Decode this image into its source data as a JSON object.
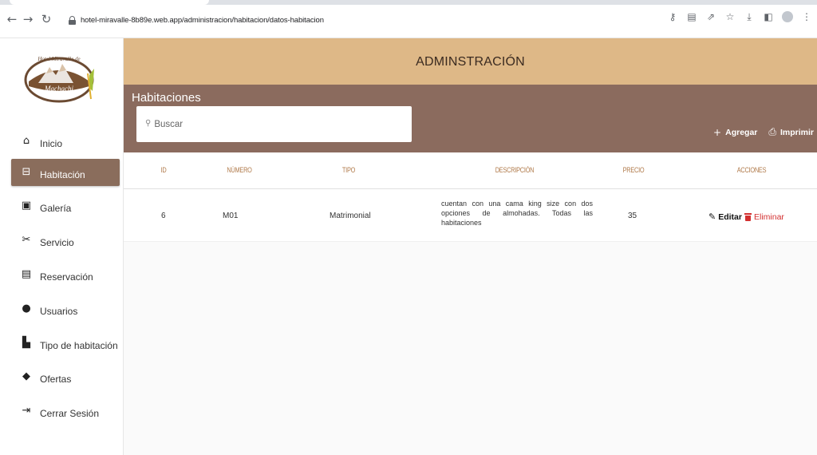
{
  "browser": {
    "url": "hotel-miravalle-8b89e.web.app/administracion/habitacion/datos-habitacion",
    "back_icon": "arrow-left-icon",
    "forward_icon": "arrow-right-icon",
    "reload_icon": "reload-icon"
  },
  "logo": {
    "top_text": "Hotel Miravalle de",
    "bottom_text": "Machachi"
  },
  "sidebar": {
    "items": [
      {
        "label": "Inicio",
        "icon": "home-icon"
      },
      {
        "label": "Habitación",
        "icon": "bed-icon",
        "active": true
      },
      {
        "label": "Galería",
        "icon": "gallery-icon"
      },
      {
        "label": "Servicio",
        "icon": "service-icon"
      },
      {
        "label": "Reservación",
        "icon": "reservation-icon"
      },
      {
        "label": "Usuarios",
        "icon": "user-icon"
      },
      {
        "label": "Tipo de habitación",
        "icon": "room-type-icon"
      },
      {
        "label": "Ofertas",
        "icon": "tag-icon"
      },
      {
        "label": "Cerrar Sesión",
        "icon": "logout-icon"
      }
    ]
  },
  "header": {
    "title": "ADMINSTRACIÓN"
  },
  "sub": {
    "title": "Habitaciones",
    "search_placeholder": "Buscar",
    "add_label": "Agregar",
    "print_label": "Imprimir"
  },
  "table": {
    "columns": [
      "ID",
      "NÚMERO",
      "TIPO",
      "DESCRIPCIÓN",
      "PRECIO",
      "ACCIONES"
    ],
    "rows": [
      {
        "id": "6",
        "numero": "M01",
        "tipo": "Matrimonial",
        "descripcion": "cuentan con una cama king size con dos opciones de almohadas. Todas las habitaciones",
        "precio": "35",
        "edit_label": "Editar",
        "delete_label": "Eliminar"
      }
    ]
  },
  "colors": {
    "header_bg": "#deb887",
    "subheader_bg": "#8b6b5e",
    "active_nav": "#8a6d5c",
    "column_header_text": "#b07a4a",
    "delete_red": "#d32f2f"
  }
}
